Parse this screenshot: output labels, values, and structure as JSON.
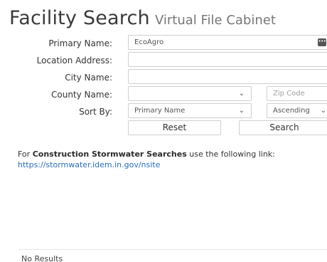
{
  "header": {
    "title": "Facility Search",
    "subtitle": "Virtual File Cabinet"
  },
  "form": {
    "primary_name": {
      "label": "Primary Name:",
      "value": "EcoAgro",
      "icon": "ellipsis-icon"
    },
    "location_address": {
      "label": "Location Address:",
      "value": ""
    },
    "city_name": {
      "label": "City Name:",
      "value": ""
    },
    "county_name": {
      "label": "County Name:",
      "value": ""
    },
    "zip_code": {
      "placeholder": "Zip Code"
    },
    "sort_by": {
      "label": "Sort By:",
      "field_value": "Primary Name",
      "order_value": "Ascending"
    },
    "reset_label": "Reset",
    "search_label": "Search"
  },
  "info": {
    "prefix": "For ",
    "bold": "Construction Stormwater Searches",
    "suffix": " use the following link:",
    "link": "https://stormwater.idem.in.gov/nsite"
  },
  "results": {
    "text": "No Results"
  },
  "colors": {
    "link": "#2a6ebb",
    "border": "#cfcfcf"
  }
}
